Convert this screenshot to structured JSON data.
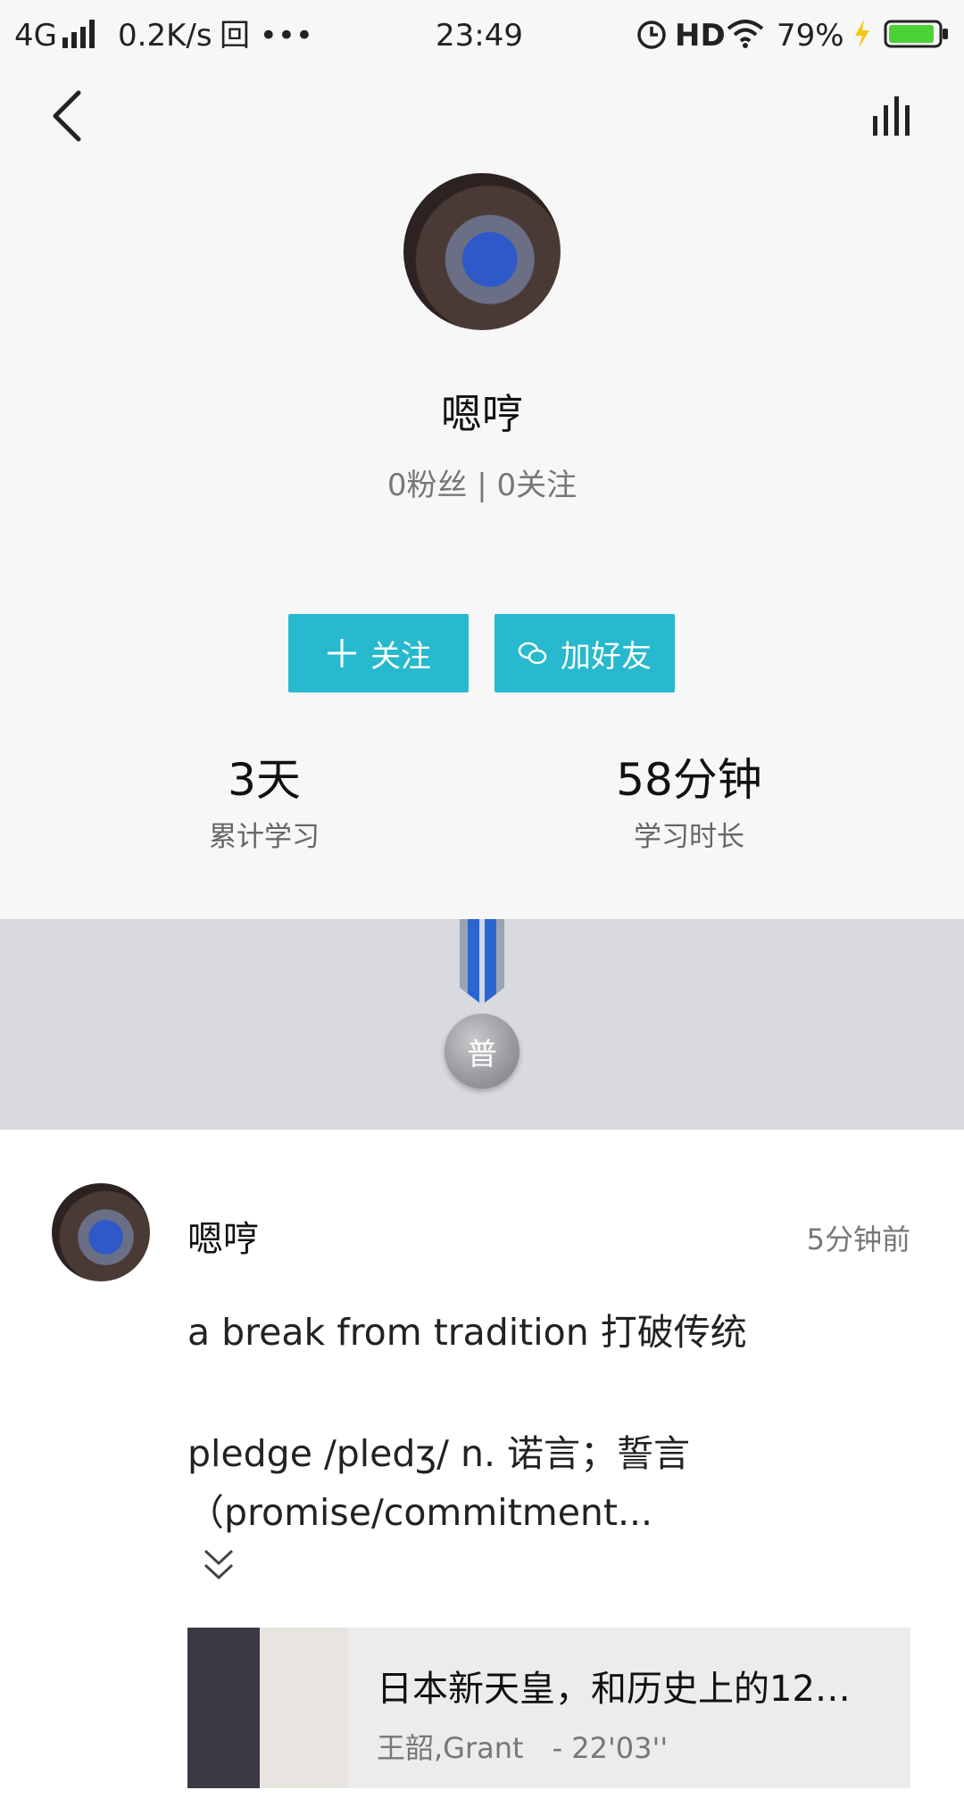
{
  "status_bar": {
    "network": "4G",
    "speed": "0.2K/s",
    "extra": "回 •••",
    "time": "23:49",
    "hd": "HD",
    "battery": "79%"
  },
  "profile": {
    "name": "嗯哼",
    "fans_follow": "0粉丝 | 0关注",
    "follow_button": "关注",
    "add_friend_button": "加好友",
    "stats": [
      {
        "value": "3天",
        "label": "累计学习"
      },
      {
        "value": "58分钟",
        "label": "学习时长"
      }
    ],
    "medal_label": "普"
  },
  "post": {
    "author": "嗯哼",
    "time": "5分钟前",
    "line1": "a break from tradition 打破传统",
    "line2": "pledge /pledʒ/ n. 诺言；誓言",
    "line3": "（promise/commitment...",
    "card_title": "日本新天皇，和历史上的12…",
    "card_meta": "王韶,Grant　- 22'03''"
  },
  "icons": [
    "back-arrow-icon",
    "stats-icon",
    "signal-icon",
    "alarm-icon",
    "wifi-icon",
    "battery-icon",
    "plus-icon",
    "wechat-icon",
    "expand-chevron-icon"
  ],
  "colors": {
    "accent": "#27b9cd",
    "badge_band": "#d8dadf",
    "battery_green": "#4cd137"
  }
}
